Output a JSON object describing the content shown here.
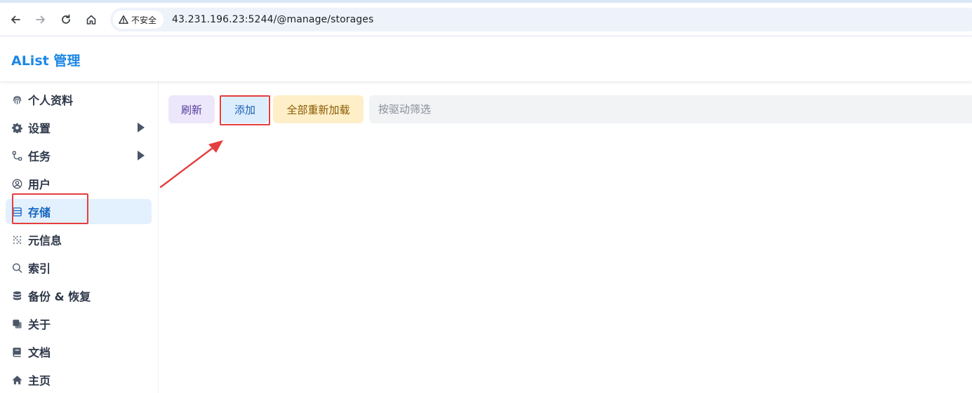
{
  "browser": {
    "security_label": "不安全",
    "url": "43.231.196.23:5244/@manage/storages"
  },
  "app": {
    "title": "AList 管理"
  },
  "sidebar": {
    "items": [
      {
        "label": "个人资料",
        "icon": "fingerprint-icon"
      },
      {
        "label": "设置",
        "icon": "gear-icon"
      },
      {
        "label": "任务",
        "icon": "workflow-icon"
      },
      {
        "label": "用户",
        "icon": "user-circle-icon"
      },
      {
        "label": "存储",
        "icon": "database-list-icon"
      },
      {
        "label": "元信息",
        "icon": "grid-icon"
      },
      {
        "label": "索引",
        "icon": "search-icon"
      },
      {
        "label": "备份 & 恢复",
        "icon": "database-icon"
      },
      {
        "label": "关于",
        "icon": "copy-icon"
      },
      {
        "label": "文档",
        "icon": "book-icon"
      },
      {
        "label": "主页",
        "icon": "home-icon"
      }
    ],
    "active": "存储"
  },
  "toolbar": {
    "refresh_label": "刷新",
    "add_label": "添加",
    "reload_all_label": "全部重新加载",
    "filter_placeholder": "按驱动筛选"
  },
  "colors": {
    "brand": "#1e88e5",
    "active_bg": "#e3f0fd",
    "annotation": "#e53e3e"
  }
}
